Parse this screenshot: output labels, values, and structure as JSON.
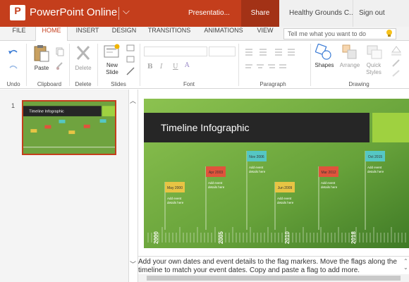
{
  "titlebar": {
    "logo_letter": "P",
    "app_name": "PowerPoint Online",
    "doc_name": "Presentatio...",
    "share_label": "Share",
    "user_name": "Healthy Grounds C...",
    "signout_label": "Sign out",
    "color": "#c43e1c"
  },
  "tabs": [
    "FILE",
    "HOME",
    "INSERT",
    "DESIGN",
    "TRANSITIONS",
    "ANIMATIONS",
    "VIEW"
  ],
  "active_tab": "HOME",
  "tell_me": {
    "placeholder": "Tell me what you want to do",
    "icon": "lightbulb-icon"
  },
  "ribbon": {
    "undo": {
      "label": "Undo"
    },
    "clipboard": {
      "label": "Clipboard",
      "paste": "Paste"
    },
    "delete": {
      "label": "Delete",
      "button": "Delete"
    },
    "slides": {
      "label": "Slides",
      "new_slide_line1": "New",
      "new_slide_line2": "Slide"
    },
    "font": {
      "label": "Font",
      "bold": "B",
      "italic": "I",
      "underline": "U",
      "color": "A"
    },
    "paragraph": {
      "label": "Paragraph"
    },
    "drawing": {
      "label": "Drawing",
      "shapes": "Shapes",
      "arrange": "Arrange",
      "quick_styles_line1": "Quick",
      "quick_styles_line2": "Styles"
    }
  },
  "slide_panel": {
    "number": "1"
  },
  "slide": {
    "title": "Timeline Infographic",
    "background": "#6fa33f",
    "years": [
      "2000",
      "2005",
      "2010",
      "2018"
    ],
    "events": [
      {
        "flag": "May 2000",
        "detail_1": "Add event",
        "detail_2": "details here",
        "color": "#e8c444",
        "position": "low"
      },
      {
        "flag": "Apr 2003",
        "detail_1": "Add event",
        "detail_2": "details here",
        "color": "#e0533c",
        "position": "mid"
      },
      {
        "flag": "Nov 2006",
        "detail_1": "Add event",
        "detail_2": "details here",
        "color": "#55c7c4",
        "position": "high"
      },
      {
        "flag": "Jun 2009",
        "detail_1": "Add event",
        "detail_2": "details here",
        "color": "#e8c444",
        "position": "low"
      },
      {
        "flag": "Mar 2012",
        "detail_1": "Add event",
        "detail_2": "details here",
        "color": "#e0533c",
        "position": "mid"
      },
      {
        "flag": "Oct 2015",
        "detail_1": "Add event",
        "detail_2": "details here",
        "color": "#55c7c4",
        "position": "high"
      }
    ]
  },
  "notes": {
    "text": "Add your own dates and event details to the flag markers. Move the flags along the timeline to match your event dates. Copy and paste a flag to add more."
  }
}
